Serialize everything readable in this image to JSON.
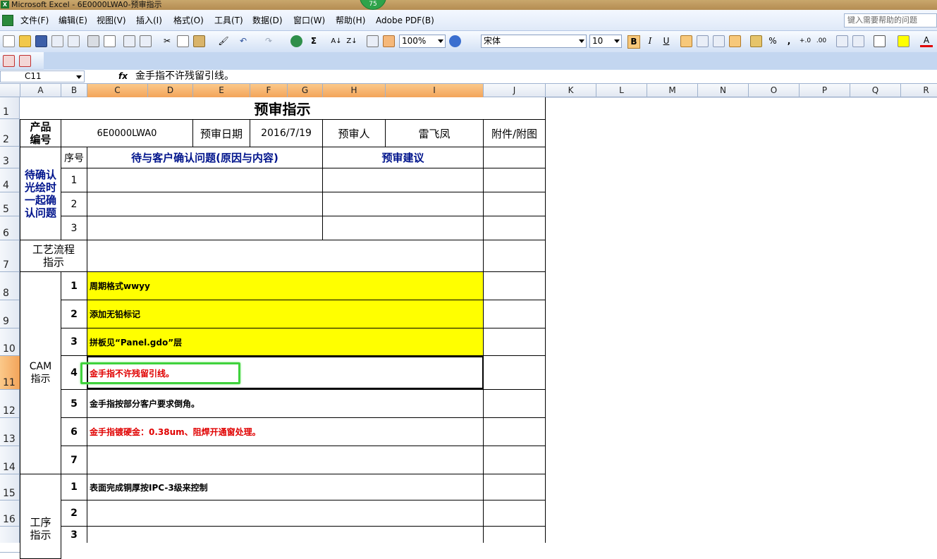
{
  "window": {
    "title": "Microsoft Excel - 6E0000LWA0-预审指示",
    "badge": "75",
    "app_icon": "X"
  },
  "menu": [
    "文件(F)",
    "编辑(E)",
    "视图(V)",
    "插入(I)",
    "格式(O)",
    "工具(T)",
    "数据(D)",
    "窗口(W)",
    "帮助(H)",
    "Adobe PDF(B)"
  ],
  "help_placeholder": "键入需要帮助的问题",
  "toolbar": {
    "zoom": "100%",
    "font": "宋体",
    "font_size": "10",
    "bold": "B",
    "italic": "I",
    "underline": "U",
    "sigma": "Σ",
    "percent": "%",
    "comma": ","
  },
  "formula_bar": {
    "cell_ref": "C11",
    "fx": "fx",
    "value": "金手指不许残留引线。"
  },
  "columns": [
    "A",
    "B",
    "C",
    "D",
    "E",
    "F",
    "G",
    "H",
    "I",
    "J",
    "K",
    "L",
    "M",
    "N",
    "O",
    "P",
    "Q",
    "R"
  ],
  "rows": [
    "1",
    "2",
    "3",
    "4",
    "5",
    "6",
    "7",
    "8",
    "9",
    "10",
    "11",
    "12",
    "13",
    "14",
    "15",
    "16"
  ],
  "sheet": {
    "title": "预审指示",
    "product_label": "产品编号",
    "product_no": "6E0000LWA0",
    "review_date_label": "预审日期",
    "review_date": "2016/7/19",
    "reviewer_label": "预审人",
    "reviewer": "雷飞凤",
    "attach_label": "附件/附图",
    "confirm_section": "待确认光绘时一起确认问题",
    "seq_label": "序号",
    "issue_header": "待与客户确认问题(原因与内容)",
    "suggest_header": "预审建议",
    "confirm_nums": [
      "1",
      "2",
      "3"
    ],
    "process_label": "工艺流程指示",
    "cam_label": "CAM指示",
    "cam_items": [
      {
        "num": "1",
        "text": "周期格式wwyy"
      },
      {
        "num": "2",
        "text": "添加无铅标记"
      },
      {
        "num": "3",
        "text": "拼板见“Panel.gdo”层"
      },
      {
        "num": "4",
        "text": "金手指不许残留引线。"
      },
      {
        "num": "5",
        "text": "金手指按部分客户要求倒角。"
      },
      {
        "num": "6",
        "text": "金手指镀硬金：0.38um、阻焊开通窗处理。"
      },
      {
        "num": "7",
        "text": ""
      }
    ],
    "process2_label": "工序指示",
    "process_items": [
      {
        "num": "1",
        "text": "表面完成铜厚按IPC-3级来控制"
      },
      {
        "num": "2",
        "text": ""
      },
      {
        "num": "3",
        "text": ""
      }
    ]
  },
  "colors": {
    "highlight_yellow": "#ffff00",
    "red_text": "#e00000",
    "blue_text": "#00148c",
    "annotation_green": "#3fd23c",
    "header_selected": "#f3a45a"
  }
}
